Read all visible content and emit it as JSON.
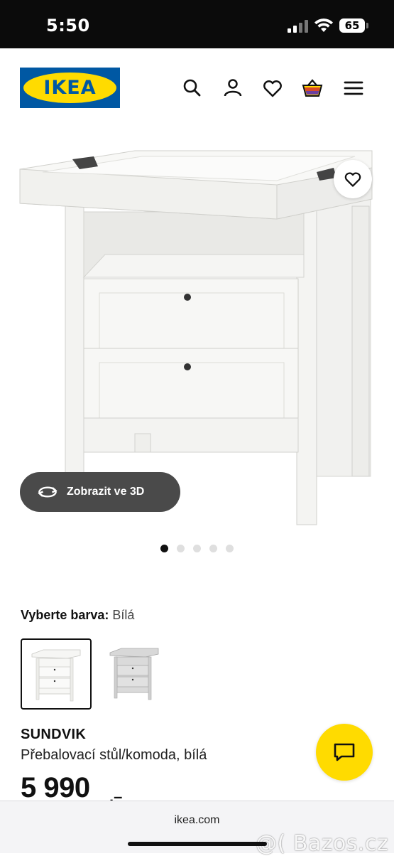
{
  "status_bar": {
    "time": "5:50",
    "battery": "65"
  },
  "brand": {
    "logo_text": "IKEA",
    "blue": "#0058a3",
    "yellow": "#ffdb00"
  },
  "header": {
    "icons": [
      "search-icon",
      "account-icon",
      "heart-icon",
      "basket-icon",
      "menu-icon"
    ]
  },
  "product_gallery": {
    "view3d_label": "Zobrazit ve 3D",
    "image_count": 5,
    "active_index": 0
  },
  "color_selector": {
    "label": "Vyberte barva:",
    "value": "Bílá",
    "options": [
      "white",
      "grey"
    ],
    "selected_index": 0
  },
  "product": {
    "name": "SUNDVIK",
    "description": "Přebalovací stůl/komoda, bílá",
    "price": "5 990",
    "price_suffix": ",–"
  },
  "browser": {
    "url": "ikea.com"
  },
  "watermark": "@( Bazos.cz"
}
